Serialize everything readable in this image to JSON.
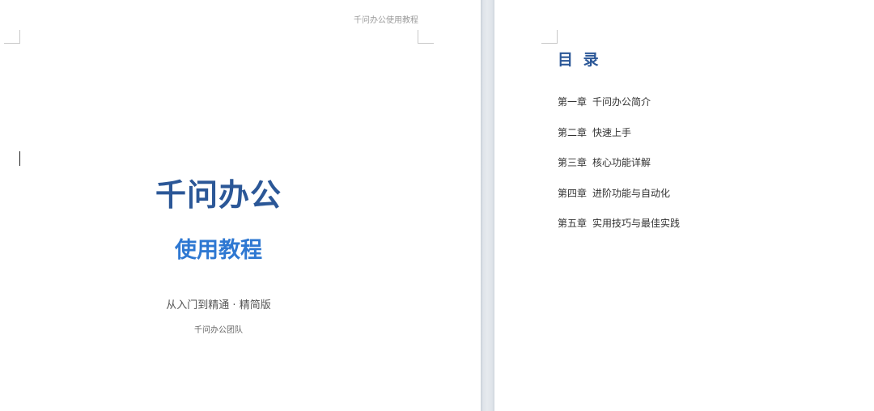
{
  "cover_page": {
    "header": "千问办公使用教程",
    "title": "千问办公",
    "subtitle": "使用教程",
    "tagline": "从入门到精通 · 精简版",
    "author": "千问办公团队"
  },
  "toc_page": {
    "title": "目 录",
    "items": [
      {
        "chapter": "第一章",
        "name": "千问办公简介"
      },
      {
        "chapter": "第二章",
        "name": "快速上手"
      },
      {
        "chapter": "第三章",
        "name": "核心功能详解"
      },
      {
        "chapter": "第四章",
        "name": "进阶功能与自动化"
      },
      {
        "chapter": "第五章",
        "name": "实用技巧与最佳实践"
      }
    ]
  },
  "colors": {
    "title_blue": "#2b5797",
    "subtitle_blue": "#2e78d2",
    "page_gutter": "#dfe3e8"
  }
}
